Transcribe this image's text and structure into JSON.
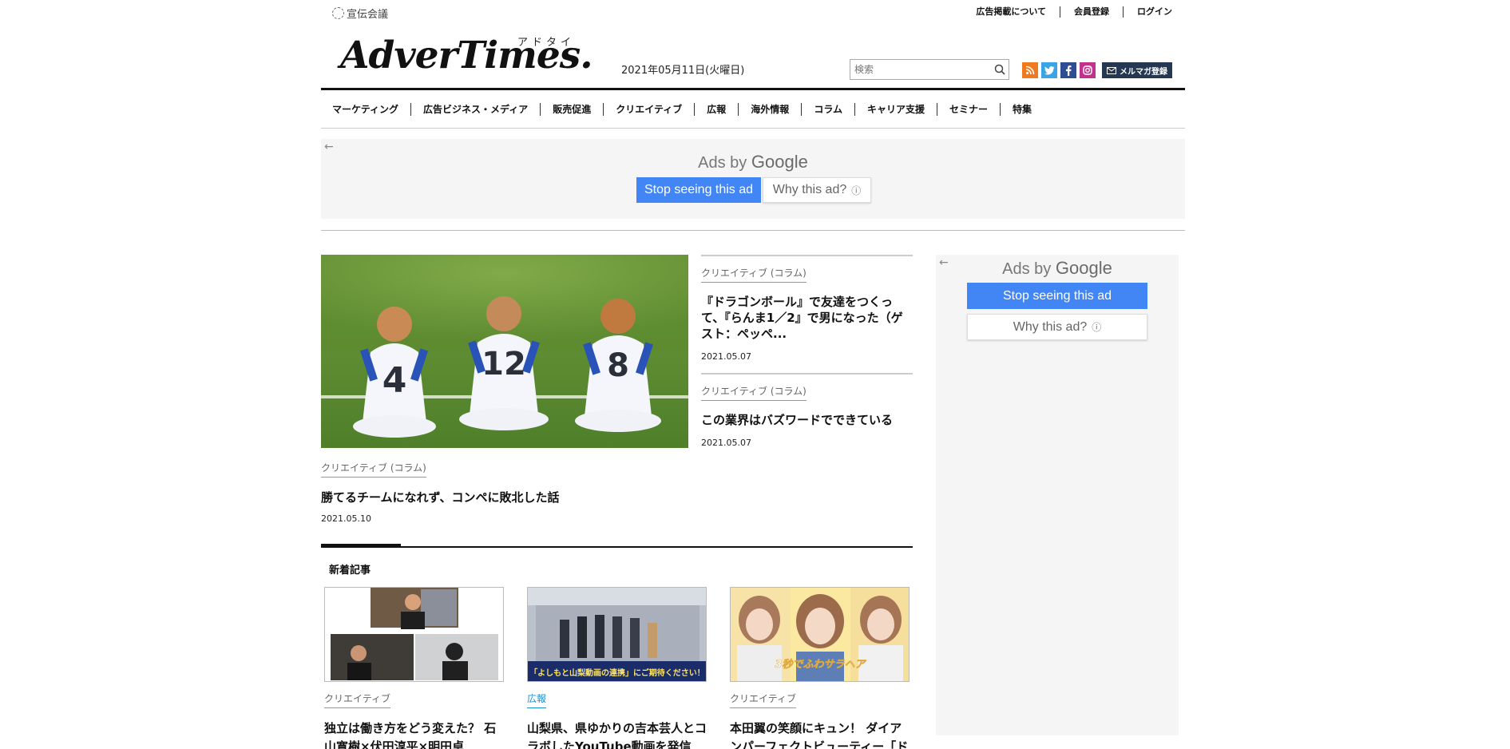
{
  "header": {
    "network_name": "宣伝会議",
    "top_links": [
      "広告掲載について",
      "会員登録",
      "ログイン"
    ],
    "brand_name": "AdverTimes.",
    "brand_kana": "アドタイ",
    "date": "2021年05月11日(火曜日)",
    "search_placeholder": "検索",
    "mail_button": "メルマガ登録"
  },
  "nav": {
    "items": [
      "マーケティング",
      "広告ビジネス・メディア",
      "販売促進",
      "クリエイティブ",
      "広報",
      "海外情報",
      "コラム",
      "キャリア支援",
      "セミナー",
      "特集"
    ]
  },
  "ads": {
    "ads_by": "Ads by",
    "google": "Google",
    "stop_label": "Stop seeing this ad",
    "why_label": "Why this ad?"
  },
  "featured": {
    "category": "クリエイティブ (コラム)",
    "title": "勝てるチームになれず、コンペに敗北した話",
    "date": "2021.05.10",
    "jersey_numbers": [
      "4",
      "12",
      "8"
    ],
    "side_articles": [
      {
        "category": "クリエイティブ (コラム)",
        "title": "『ドラゴンボール』で友達をつくって、『らんま1／2』で男になった（ゲスト：ペッペ...",
        "date": "2021.05.07"
      },
      {
        "category": "クリエイティブ (コラム)",
        "title": "この業界はバズワードでできている",
        "date": "2021.05.07"
      }
    ]
  },
  "new_articles": {
    "label": "新着記事",
    "items": [
      {
        "category": "クリエイティブ",
        "title": "独立は働き方をどう変えた？ 石山寛樹×伏田淳平×明田卓"
      },
      {
        "category": "広報",
        "title": "山梨県、県ゆかりの吉本芸人とコラボしたYouTube動画を発信"
      },
      {
        "category": "クリエイティブ",
        "title": "本田翼の笑顔にキュン！ ダイアンパーフェクトビューティー「ド"
      }
    ],
    "thumb2_caption": "「よしもと山梨動画の連携」にご期待ください！",
    "thumb3_caption": "3秒でふわサラヘア"
  },
  "colors": {
    "accent_blue": "#4285f4",
    "category_blue": "#1a8fd0",
    "navy": "#243753"
  }
}
